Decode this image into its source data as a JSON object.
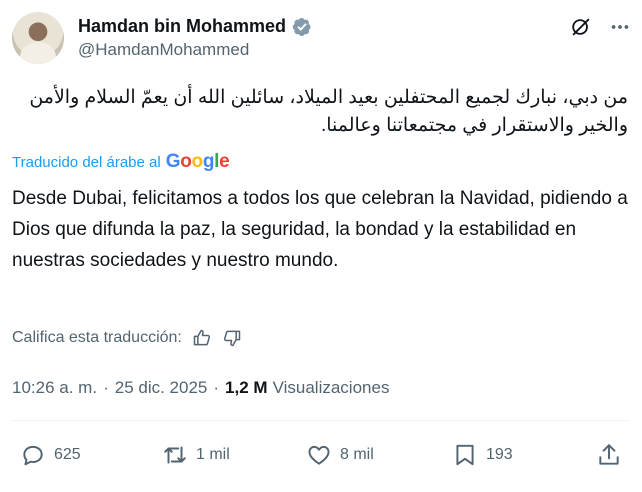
{
  "author": {
    "name": "Hamdan bin Mohammed",
    "handle": "@HamdanMohammed",
    "verified": true
  },
  "post": {
    "arabic_text": "من دبي، نبارك لجميع المحتفلين بعيد الميلاد، سائلين الله أن يعمّ السلام والأمن والخير والاستقرار في مجتمعاتنا وعالمنا.",
    "translated_label": "Traducido del árabe al",
    "translator_brand": [
      "G",
      "o",
      "o",
      "g",
      "l",
      "e"
    ],
    "translation": "Desde Dubai, felicitamos a todos los que celebran la Navidad, pidiendo a Dios que difunda la paz, la seguridad, la bondad y la estabilidad en nuestras sociedades y nuestro mundo.",
    "rate_label": "Califica esta traducción:"
  },
  "meta": {
    "time": "10:26 a. m.",
    "separator": "·",
    "date": "25 dic. 2025",
    "views_count": "1,2 M",
    "views_label": "Visualizaciones"
  },
  "actions": {
    "replies": "625",
    "reposts": "1 mil",
    "likes": "8 mil",
    "bookmarks": "193"
  },
  "colors": {
    "accent": "#1d9bf0",
    "secondary_text": "#536471",
    "primary_text": "#0f1419"
  },
  "icons": [
    "verified-badge-icon",
    "grok-icon",
    "more-icon",
    "thumbs-up-icon",
    "thumbs-down-icon",
    "reply-icon",
    "repost-icon",
    "like-icon",
    "bookmark-icon",
    "share-icon"
  ]
}
